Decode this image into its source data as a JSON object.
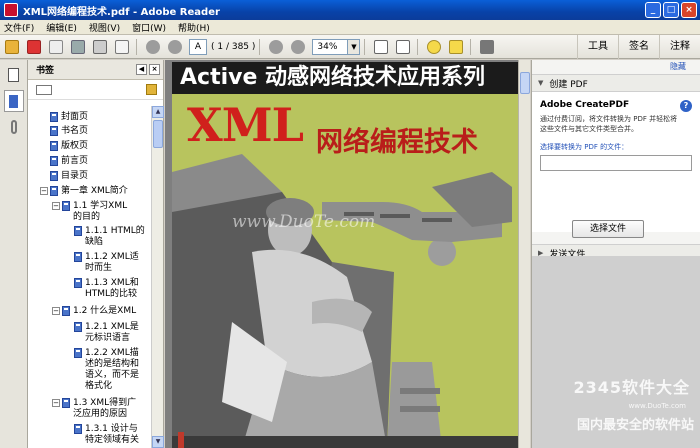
{
  "window": {
    "title": "XML网络编程技术.pdf - Adobe Reader"
  },
  "menu": [
    "文件(F)",
    "编辑(E)",
    "视图(V)",
    "窗口(W)",
    "帮助(H)"
  ],
  "toolbar": {
    "page_current": "A",
    "page_count": "( 1 / 385 )",
    "zoom": "34%",
    "right_tabs": [
      "工具",
      "签名",
      "注释"
    ]
  },
  "bookmarks": {
    "header": "书签",
    "items": [
      {
        "label": "封面页",
        "level": 0,
        "expander": ""
      },
      {
        "label": "书名页",
        "level": 0,
        "expander": ""
      },
      {
        "label": "版权页",
        "level": 0,
        "expander": ""
      },
      {
        "label": "前言页",
        "level": 0,
        "expander": ""
      },
      {
        "label": "目录页",
        "level": 0,
        "expander": ""
      },
      {
        "label": "第一章  XML简介",
        "level": 0,
        "expander": "−"
      },
      {
        "label": "1.1  学习XML的目的",
        "level": 1,
        "expander": "−"
      },
      {
        "label": "1.1.1  HTML的缺陷",
        "level": 2,
        "expander": ""
      },
      {
        "label": "1.1.2  XML适时而生",
        "level": 2,
        "expander": ""
      },
      {
        "label": "1.1.3  XML和HTML的比较",
        "level": 2,
        "expander": ""
      },
      {
        "label": "1.2  什么是XML",
        "level": 1,
        "expander": "−"
      },
      {
        "label": "1.2.1  XML是元标识语言",
        "level": 2,
        "expander": ""
      },
      {
        "label": "1.2.2  XML描述的是结构和语义，而不是格式化",
        "level": 2,
        "expander": ""
      },
      {
        "label": "1.3  XML得到广泛应用的原因",
        "level": 1,
        "expander": "−"
      },
      {
        "label": "1.3.1  设计与特定领域有关",
        "level": 2,
        "expander": ""
      }
    ]
  },
  "cover": {
    "series": "Active 动感网络技术应用系列",
    "title_main": "XML",
    "title_sub": "网络编程技术",
    "watermark": "www.DuoTe.com"
  },
  "tasks": {
    "hide": "隐藏",
    "create_section": "创建 PDF",
    "create_title": "Adobe CreatePDF",
    "create_desc": "通过付费订阅，将文件转换为 PDF 并轻松将这些文件与其它文件类型合并。",
    "select_label": "选择要转换为 PDF 的文件：",
    "choose_button": "选择文件",
    "send_section": "发送文件"
  },
  "site_watermark": {
    "brand": "2345软件大全",
    "url": "www.DuoTe.com",
    "slogan": "国内最安全的软件站"
  },
  "colors": {
    "title_bar": "#0842a8",
    "cover_red": "#d0201c",
    "cover_green": "#b8c45e"
  }
}
